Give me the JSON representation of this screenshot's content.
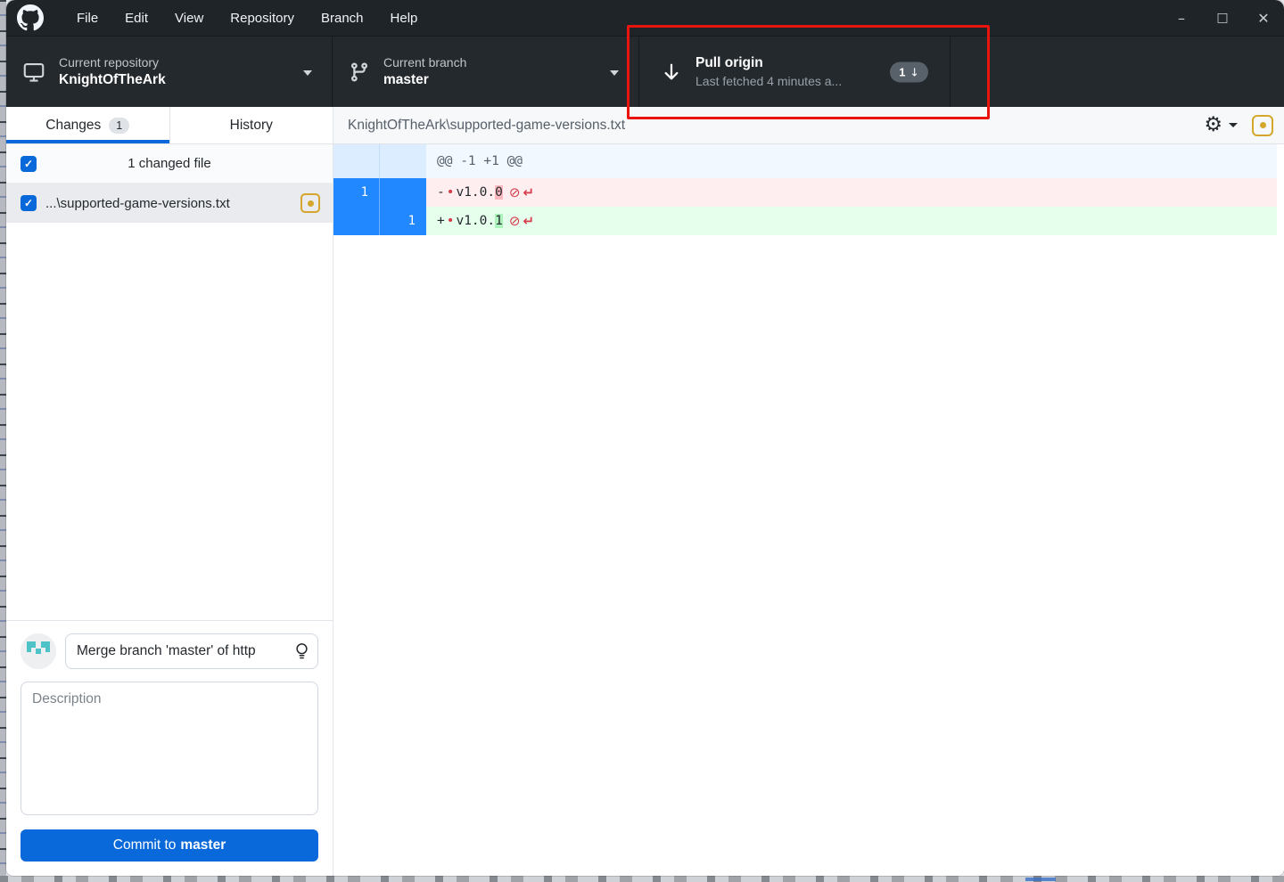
{
  "menu_bar": {
    "items": [
      "File",
      "Edit",
      "View",
      "Repository",
      "Branch",
      "Help"
    ]
  },
  "window_controls": {
    "minimize": "–",
    "maximize": "□",
    "close": "✕"
  },
  "toolbar": {
    "repository": {
      "label": "Current repository",
      "value": "KnightOfTheArk"
    },
    "branch": {
      "label": "Current branch",
      "value": "master"
    },
    "pull": {
      "title": "Pull origin",
      "subtitle": "Last fetched 4 minutes a...",
      "badge_count": "1",
      "badge_arrow": "↓"
    }
  },
  "sidebar": {
    "tabs": [
      {
        "label": "Changes",
        "badge": "1",
        "active": true
      },
      {
        "label": "History",
        "active": false
      }
    ],
    "files_header": "1 changed file",
    "file": {
      "name": "...\\supported-game-versions.txt",
      "status": "modified",
      "checked": true
    },
    "commit": {
      "summary_value": "Merge branch 'master' of http",
      "description_placeholder": "Description",
      "button_prefix": "Commit to",
      "button_branch": "master"
    }
  },
  "diff": {
    "file_path": "KnightOfTheArk\\supported-game-versions.txt",
    "hunk_header": "@@ -1 +1 @@",
    "rows": [
      {
        "type": "removed",
        "old_line": "1",
        "new_line": "",
        "sign": "-",
        "whitespace_dot": "•",
        "body": "v1.0.",
        "highlight": "0",
        "no_newline_symbol": "⊘",
        "return_symbol": "↵"
      },
      {
        "type": "added",
        "old_line": "",
        "new_line": "1",
        "sign": "+",
        "whitespace_dot": "•",
        "body": "v1.0.",
        "highlight": "1",
        "no_newline_symbol": "⊘",
        "return_symbol": "↵"
      }
    ]
  },
  "icons": {
    "gear": "⚙",
    "check": "✓"
  },
  "colors": {
    "annotation_red": "#e8140d",
    "accent_blue": "#0969da",
    "gutter_selected_blue": "#2188ff",
    "removed_bg": "#ffeef0",
    "removed_highlight": "#fdb8c0",
    "added_bg": "#e6ffed",
    "added_highlight": "#acf2bd",
    "modified_icon_gold": "#d4a72c",
    "titlebar_bg": "#1f2428",
    "toolbar_bg": "#24292e"
  }
}
